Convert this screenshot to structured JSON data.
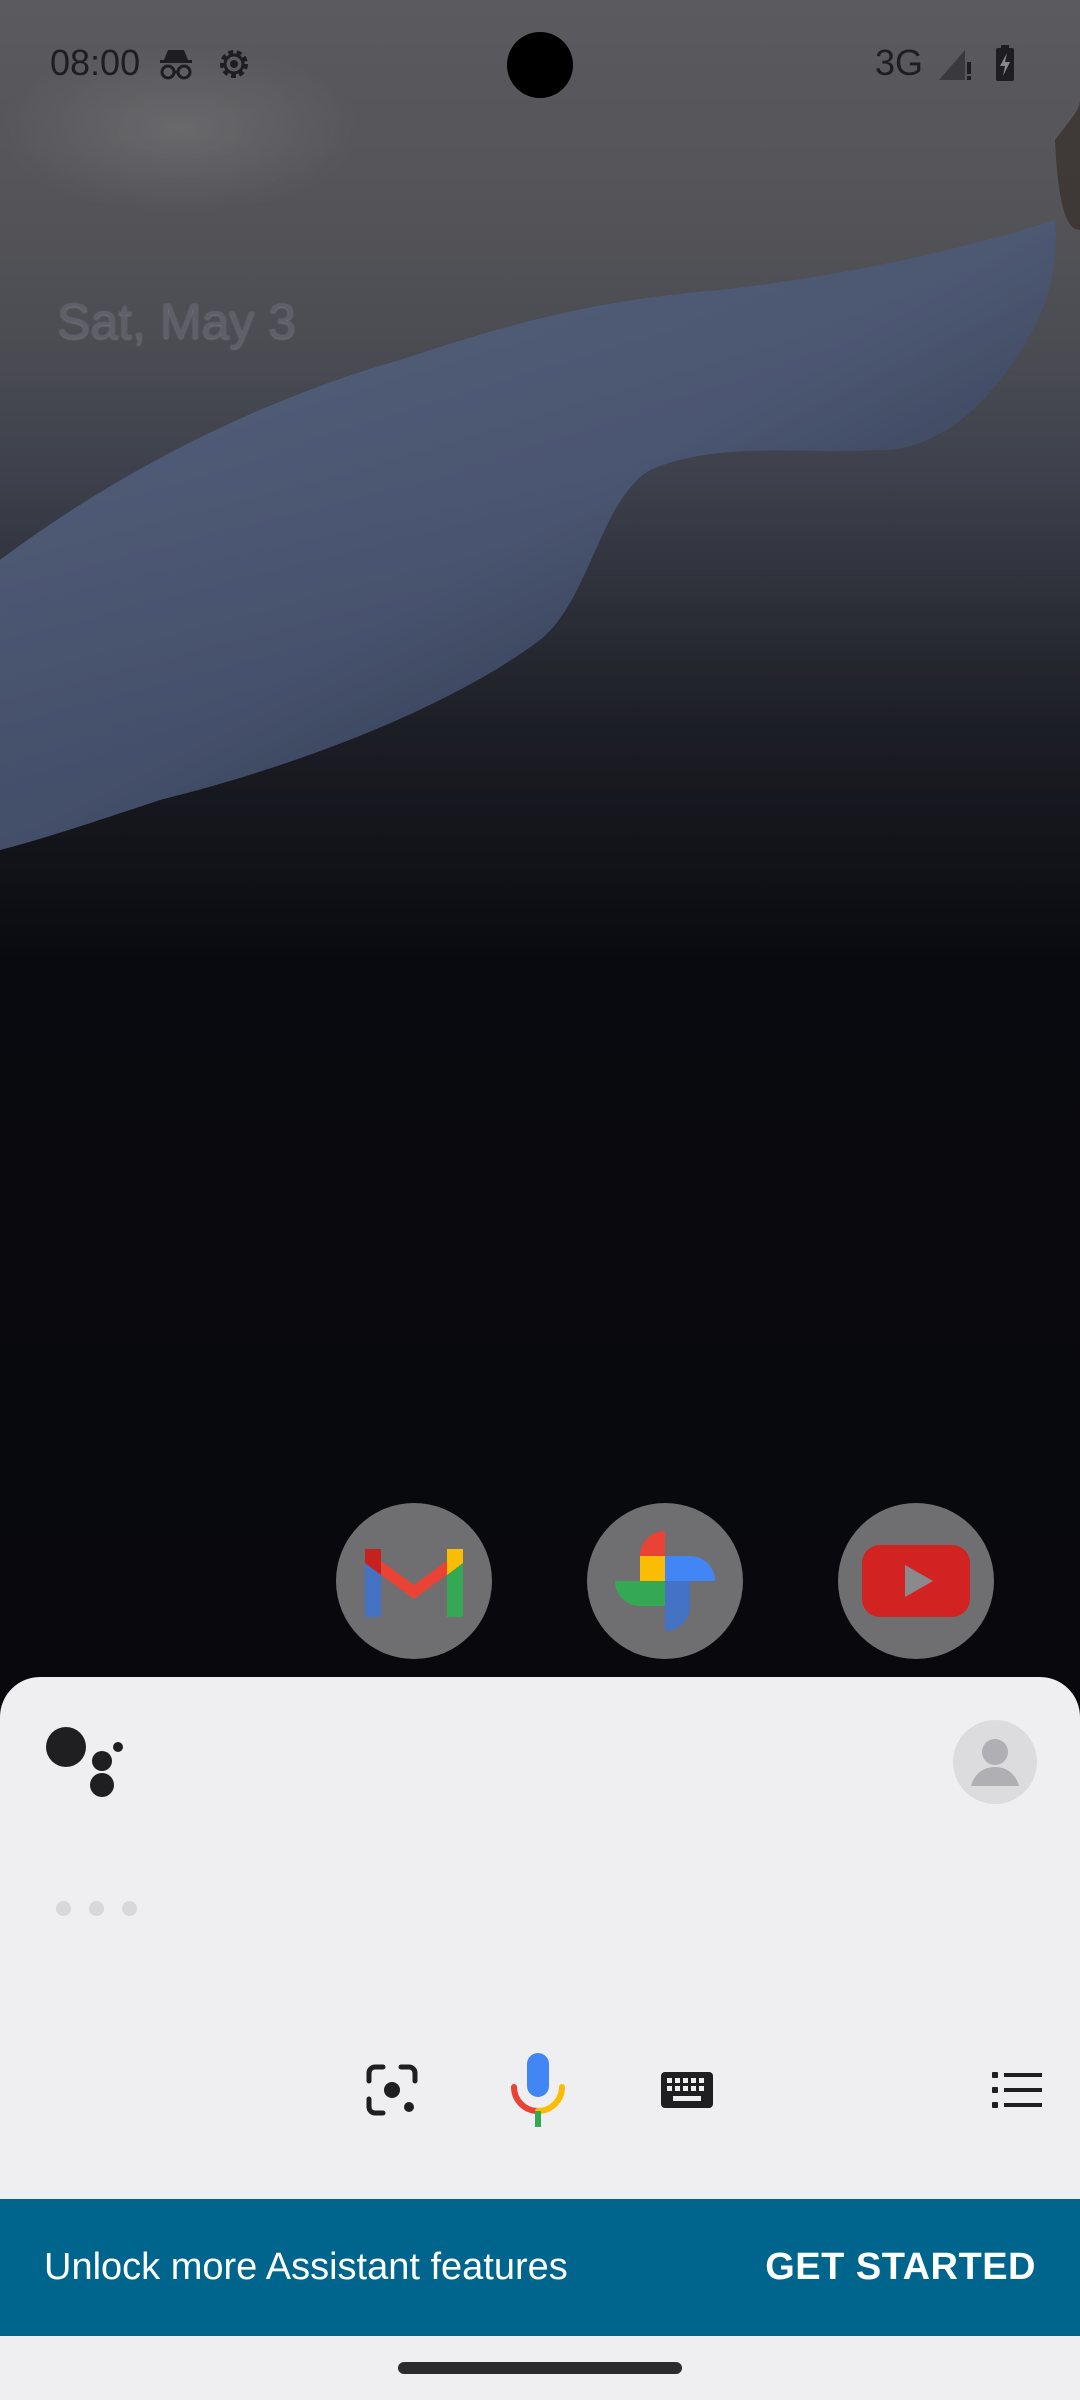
{
  "status_bar": {
    "time": "08:00",
    "network": "3G",
    "icons": [
      "incognito-icon",
      "settings-gear-icon",
      "signal-icon",
      "battery-charging-icon"
    ]
  },
  "home": {
    "date": "Sat, May 3",
    "dock_apps": [
      {
        "name": "Gmail",
        "icon": "gmail-icon"
      },
      {
        "name": "Photos",
        "icon": "photos-icon"
      },
      {
        "name": "YouTube",
        "icon": "youtube-icon"
      }
    ]
  },
  "assistant": {
    "actions": [
      "lens-icon",
      "mic-icon",
      "keyboard-icon",
      "snapshot-list-icon"
    ],
    "promo": {
      "text": "Unlock more Assistant features",
      "button": "GET STARTED"
    }
  },
  "colors": {
    "promo_bg": "#00658c",
    "sheet_bg": "#efeff1",
    "mic_blue": "#4285f4",
    "mic_red": "#ea4335",
    "mic_yellow": "#fbbc04",
    "mic_green": "#34a853"
  }
}
